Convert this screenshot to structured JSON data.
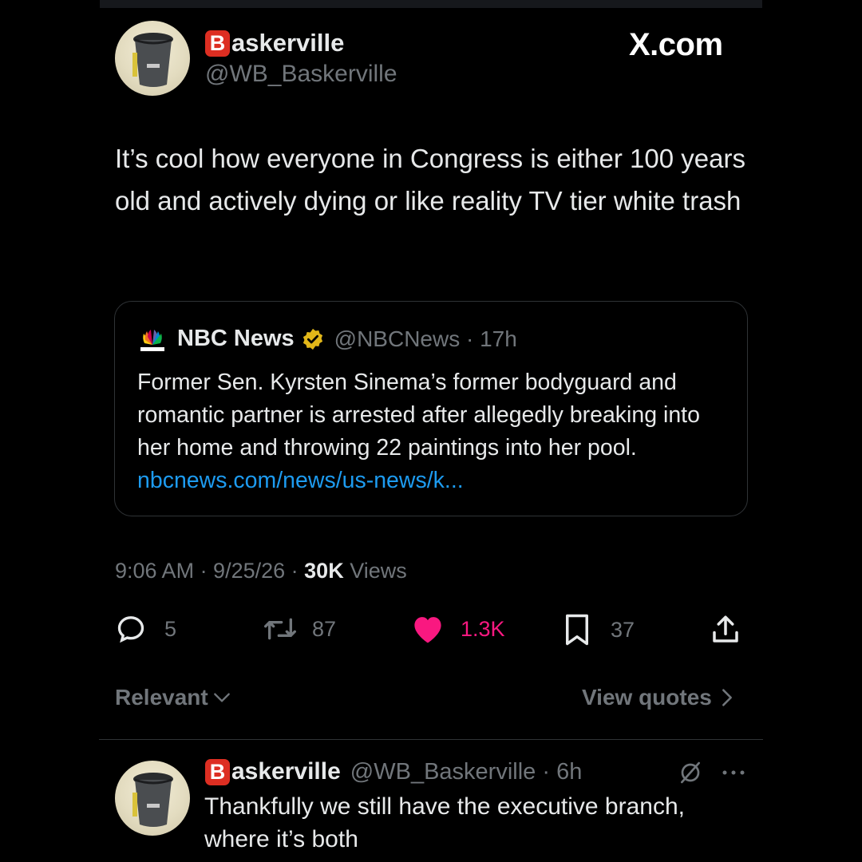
{
  "watermark": "X.com",
  "main_tweet": {
    "badge_letter": "B",
    "display_name_rest": "askerville",
    "handle": "@WB_Baskerville",
    "text": "It’s cool how everyone in Congress is either 100 years old and actively dying or like reality TV tier white trash",
    "quote": {
      "name": "NBC News",
      "handle_time": "@NBCNews · 17h",
      "text": "Former Sen. Kyrsten Sinema’s former bodyguard and romantic partner is arrested after allegedly breaking into her home and throwing 22 paintings into her pool.",
      "link": "nbcnews.com/news/us-news/k..."
    },
    "time_date": "9:06 AM · 9/25/26 ·",
    "views_count": "30K",
    "views_label": "Views",
    "actions": {
      "replies": "5",
      "reposts": "87",
      "likes": "1.3K",
      "bookmarks": "37"
    },
    "like_color": "#f91880"
  },
  "sort": {
    "label": "Relevant"
  },
  "view_quotes": {
    "label": "View quotes"
  },
  "reply": {
    "badge_letter": "B",
    "display_name_rest": "askerville",
    "handle_time": "@WB_Baskerville · 6h",
    "text": "Thankfully we still have the executive branch, where it’s both"
  }
}
